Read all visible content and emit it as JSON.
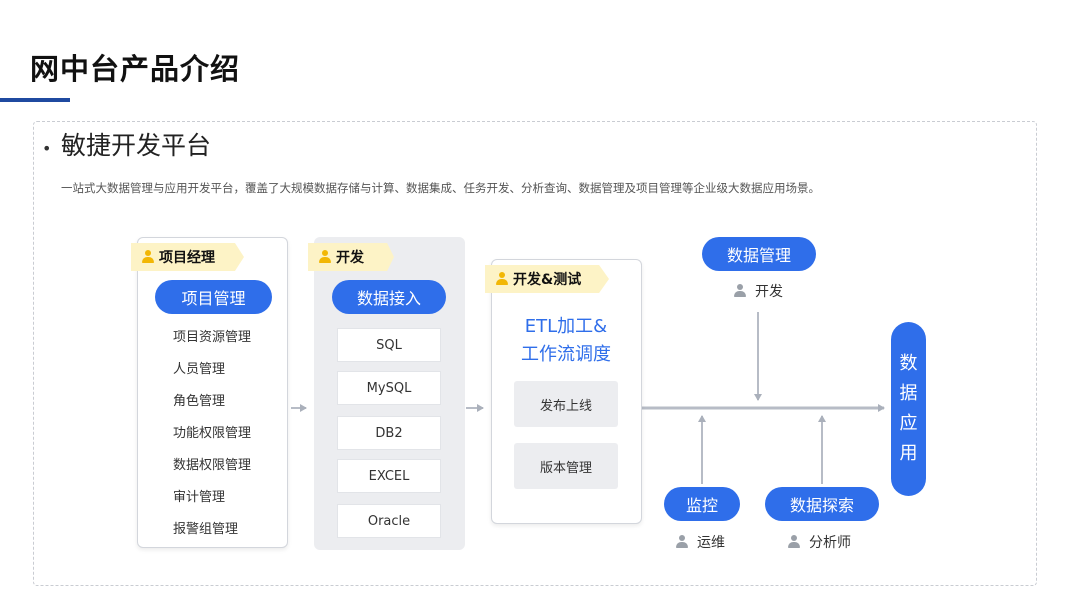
{
  "header": {
    "title": "网中台产品介绍"
  },
  "section": {
    "bullet": "•",
    "title": "敏捷开发平台",
    "description": "一站式大数据管理与应用开发平台，覆盖了大规模数据存储与计算、数据集成、任务开发、分析查询、数据管理及项目管理等企业级大数据应用场景。"
  },
  "diagram": {
    "project": {
      "role": "项目经理",
      "title": "项目管理",
      "items": [
        "项目资源管理",
        "人员管理",
        "角色管理",
        "功能权限管理",
        "数据权限管理",
        "审计管理",
        "报警组管理"
      ]
    },
    "ingest": {
      "role": "开发",
      "title": "数据接入",
      "sources": [
        "SQL",
        "MySQL",
        "DB2",
        "EXCEL",
        "Oracle"
      ]
    },
    "etl": {
      "role": "开发&测试",
      "title_line1": "ETL加工&",
      "title_line2": "工作流调度",
      "steps": [
        "发布上线",
        "版本管理"
      ]
    },
    "data_management": {
      "title": "数据管理",
      "user": "开发"
    },
    "monitor": {
      "title": "监控",
      "user": "运维"
    },
    "exploration": {
      "title": "数据探索",
      "user": "分析师"
    },
    "application": {
      "chars": [
        "数",
        "据",
        "应",
        "用"
      ]
    }
  },
  "colors": {
    "accent": "#2f6eea",
    "title_underline": "#1f4aa0",
    "role_tag_bg": "#fdf3c6",
    "role_icon": "#f2b705",
    "gray_panel": "#ecedf0",
    "arrow": "#b7bcc6"
  }
}
